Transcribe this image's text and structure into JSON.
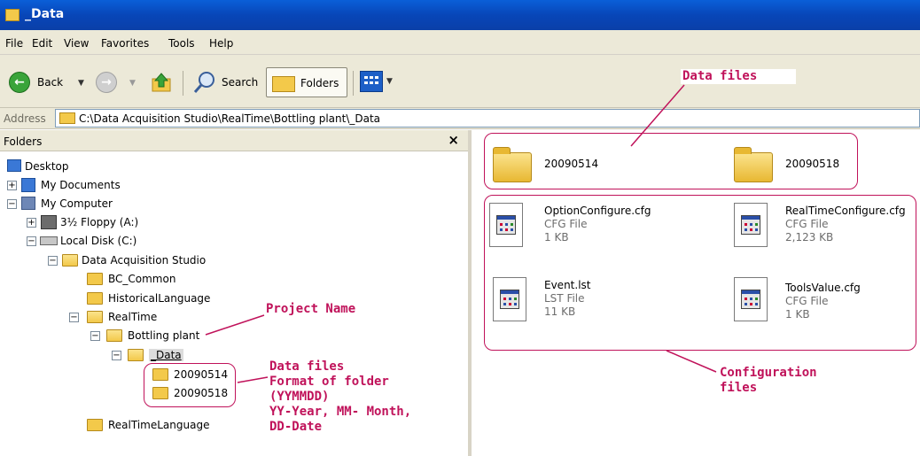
{
  "window": {
    "title": "_Data"
  },
  "menu": [
    "File",
    "Edit",
    "View",
    "Favorites",
    "Tools",
    "Help"
  ],
  "toolbar": {
    "back": "Back",
    "search": "Search",
    "folders": "Folders"
  },
  "address": {
    "label": "Address",
    "value": "C:\\Data Acquisition Studio\\RealTime\\Bottling plant\\_Data"
  },
  "folders_pane": {
    "header": "Folders",
    "close": "×",
    "tree": {
      "desktop": "Desktop",
      "my_documents": "My Documents",
      "my_computer": "My Computer",
      "floppy": "3½ Floppy (A:)",
      "local_disk": "Local Disk (C:)",
      "das": "Data Acquisition Studio",
      "bc_common": "BC_Common",
      "historical": "HistoricalLanguage",
      "realtime": "RealTime",
      "bottling": "Bottling plant",
      "data": "_Data",
      "f1": "20090514",
      "f2": "20090518",
      "rtlang": "RealTimeLanguage"
    },
    "expanders": {
      "plus": "+",
      "minus": "−"
    }
  },
  "content": {
    "folders": [
      {
        "name": "20090514"
      },
      {
        "name": "20090518"
      }
    ],
    "files": [
      {
        "name": "OptionConfigure.cfg",
        "type": "CFG File",
        "size": "1 KB"
      },
      {
        "name": "RealTimeConfigure.cfg",
        "type": "CFG File",
        "size": "2,123 KB"
      },
      {
        "name": "Event.lst",
        "type": "LST File",
        "size": "11 KB"
      },
      {
        "name": "ToolsValue.cfg",
        "type": "CFG File",
        "size": "1 KB"
      }
    ]
  },
  "annotations": {
    "data_files_top": "Data files",
    "project_name": "Project Name",
    "data_files_left": [
      "Data files",
      "Format of folder",
      "(YYMMDD)",
      "YY-Year, MM- Month,",
      "DD-Date"
    ],
    "configuration_files": [
      "Configuration",
      "files"
    ]
  },
  "colors": {
    "annotation": "#c0125a",
    "titlebar": "#0a4fc8",
    "chrome": "#ece9d8"
  }
}
